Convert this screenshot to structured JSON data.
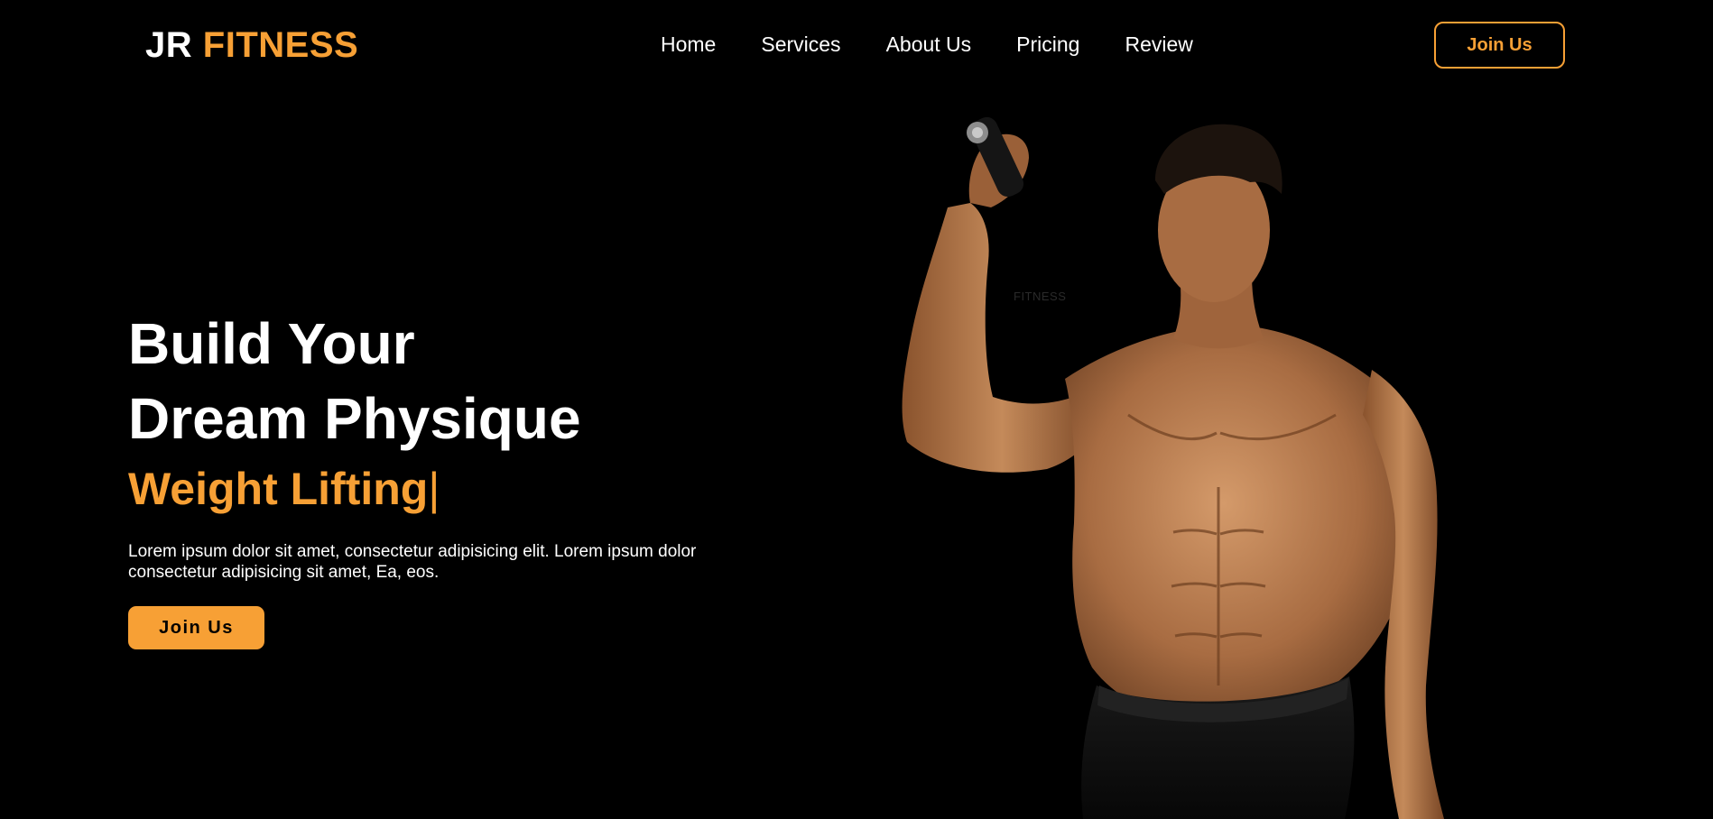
{
  "brand": {
    "part1": "JR",
    "part2": "FITNESS",
    "accent_color": "#f7a035"
  },
  "nav": {
    "items": [
      {
        "label": "Home"
      },
      {
        "label": "Services"
      },
      {
        "label": "About Us"
      },
      {
        "label": "Pricing"
      },
      {
        "label": "Review"
      }
    ],
    "cta_label": "Join Us"
  },
  "hero": {
    "title_line1": "Build Your",
    "title_line2": "Dream Physique",
    "typed_text": "Weight Lifting",
    "typed_cursor": "|",
    "description": "Lorem ipsum dolor sit amet, consectetur adipisicing elit. Lorem ipsum dolor consectetur adipisicing sit amet, Ea, eos.",
    "cta_label": "Join Us",
    "image_watermark": "FITNESS",
    "image_subject": "muscular man lifting dumbbell"
  }
}
